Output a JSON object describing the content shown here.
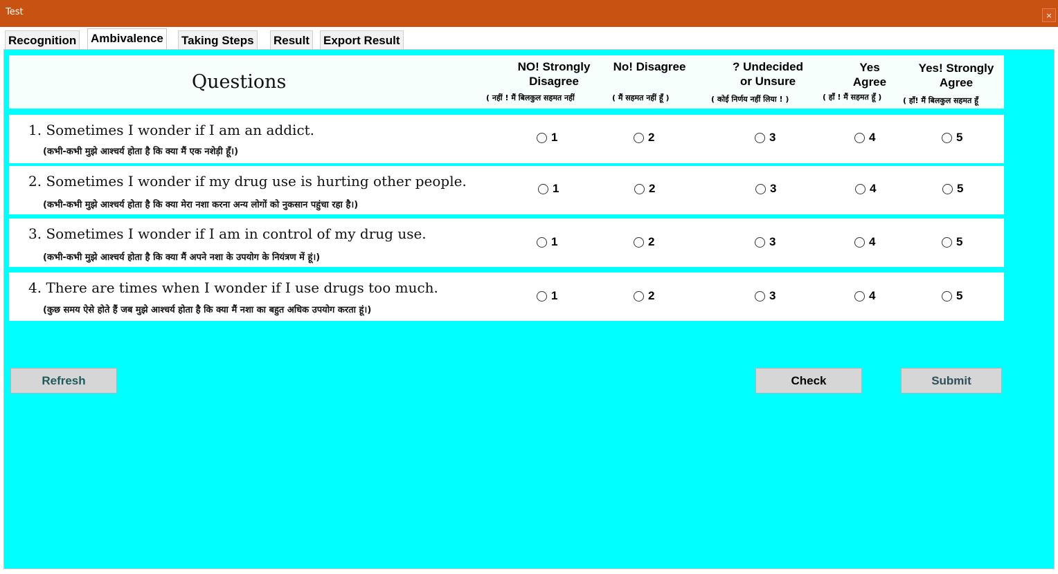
{
  "window": {
    "title": "Test",
    "close_label": "×"
  },
  "tabs": [
    {
      "label": "Recognition"
    },
    {
      "label": "Ambivalence"
    },
    {
      "label": "Taking Steps"
    },
    {
      "label": "Result"
    },
    {
      "label": "Export Result"
    }
  ],
  "active_tab": "Ambivalence",
  "header": {
    "questions_label": "Questions",
    "columns": [
      {
        "line1": "NO! Strongly",
        "line2": "Disagree",
        "hindi": "( नहीं ! मैं बिलकुल सहमत नहीं"
      },
      {
        "line1": "No! Disagree",
        "line2": "",
        "hindi": "( मैं सहमत नहीं हूँ )"
      },
      {
        "line1": "? Undecided",
        "line2": "or Unsure",
        "hindi": "( कोई निर्णय नहीं लिया ! )"
      },
      {
        "line1": "Yes",
        "line2": "Agree",
        "hindi": "( हाँ ! मैं सहमत हूँ )"
      },
      {
        "line1": "Yes! Strongly",
        "line2": "Agree",
        "hindi": "( हाँ! मैं बिलकुल सहमत हूँ"
      }
    ]
  },
  "questions": [
    {
      "english": "1. Sometimes I wonder if I am an addict.",
      "hindi": "(कभी-कभी मुझे आश्चर्य होता है कि क्या मैं एक नशेड़ी हूँ।)"
    },
    {
      "english": "2. Sometimes I wonder if my drug use is hurting other people.",
      "hindi": "(कभी-कभी मुझे आश्चर्य होता है कि क्या मेरा नशा करना अन्य लोगों को नुकसान पहुंचा रहा है।)"
    },
    {
      "english": "3. Sometimes I wonder if I am in control of my drug use.",
      "hindi": "(कभी-कभी मुझे आश्चर्य होता है कि क्या मैं अपने नशा के उपयोग के नियंत्रण में हूं।)"
    },
    {
      "english": "4. There are times when I wonder if I use drugs too much.",
      "hindi": "(कुछ समय ऐसे होते हैं जब मुझे आश्चर्य होता है कि क्या मैं नशा का बहुत अधिक उपयोग करता हूं।)"
    }
  ],
  "options": [
    "1",
    "2",
    "3",
    "4",
    "5"
  ],
  "buttons": {
    "refresh": "Refresh",
    "check": "Check",
    "submit": "Submit"
  },
  "colors": {
    "titlebar": "#c75212",
    "panel_background": "#00ffff",
    "row_background": "#ffffff",
    "header_background": "#f6fffc",
    "button_background": "#d6d6d6",
    "refresh_text": "#1f5a5a",
    "submit_text": "#2f4f5a"
  }
}
